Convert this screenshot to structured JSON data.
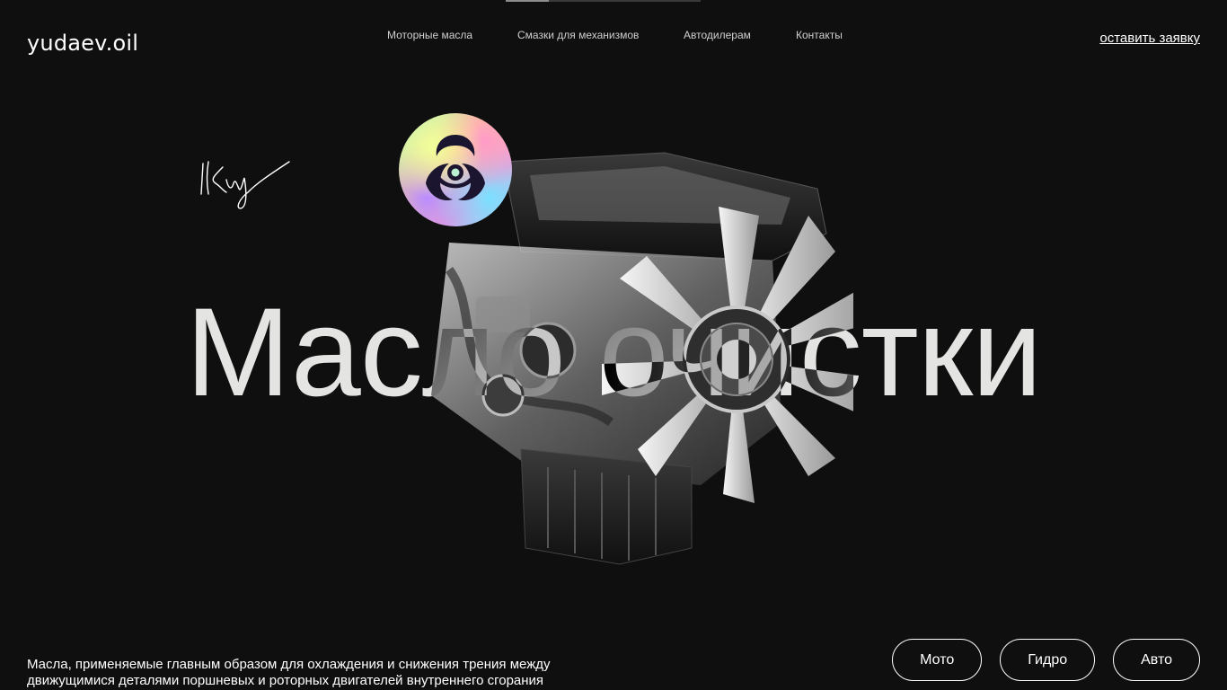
{
  "brand": {
    "logo_text": "yudaev.oil"
  },
  "slider": {
    "progress": 0.22
  },
  "nav": {
    "items": [
      {
        "label": "Моторные масла"
      },
      {
        "label": "Смазки для механизмов"
      },
      {
        "label": "Автодилерам"
      },
      {
        "label": "Контакты"
      }
    ]
  },
  "header": {
    "cta_label": "оставить заявку"
  },
  "hero": {
    "headline": "Масло очистки",
    "signature": "Клу",
    "badge_icon": "biohazard-icon",
    "image": "engine-image",
    "description": "Масла, применяемые главным образом для охлаждения и снижения трения между движущимися деталями поршневых и роторных двигателей внутреннего сгорания"
  },
  "categories": [
    {
      "label": "Мото"
    },
    {
      "label": "Гидро"
    },
    {
      "label": "Авто"
    }
  ],
  "colors": {
    "background": "#0f0f10",
    "text": "#ffffff",
    "nav_text": "#cfcfcf"
  }
}
